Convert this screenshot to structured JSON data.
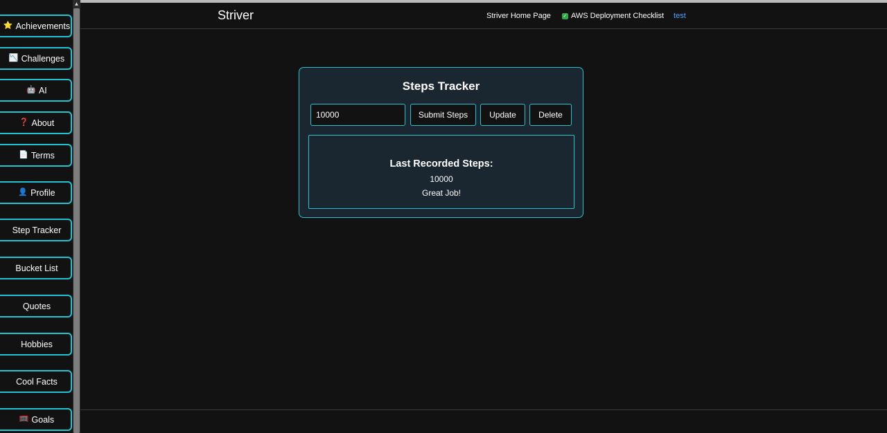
{
  "sidebar": {
    "items": [
      {
        "label": "Achievements",
        "icon": "⭐",
        "icon_name": "star-icon"
      },
      {
        "label": "Challenges",
        "icon": "📉",
        "icon_name": "chart-icon"
      },
      {
        "label": "AI",
        "icon": "🤖",
        "icon_name": "robot-icon"
      },
      {
        "label": "About",
        "icon": "❓",
        "icon_name": "question-icon"
      },
      {
        "label": "Terms",
        "icon": "📄",
        "icon_name": "document-icon"
      },
      {
        "label": "Profile",
        "icon": "👤",
        "icon_name": "user-icon"
      },
      {
        "label": "Step Tracker",
        "icon": "",
        "icon_name": ""
      },
      {
        "label": "Bucket List",
        "icon": "",
        "icon_name": ""
      },
      {
        "label": "Quotes",
        "icon": "",
        "icon_name": ""
      },
      {
        "label": "Hobbies",
        "icon": "",
        "icon_name": ""
      },
      {
        "label": "Cool Facts",
        "icon": "",
        "icon_name": ""
      },
      {
        "label": "Goals",
        "icon": "🥅",
        "icon_name": "goal-net-icon"
      }
    ]
  },
  "header": {
    "brand": "Striver",
    "nav": {
      "home": "Striver Home Page",
      "aws": "AWS Deployment Checklist",
      "test": "test"
    }
  },
  "tracker": {
    "title": "Steps Tracker",
    "input_value": "10000",
    "submit_label": "Submit Steps",
    "update_label": "Update",
    "delete_label": "Delete",
    "last_heading": "Last Recorded Steps:",
    "last_value": "10000",
    "message": "Great Job!"
  },
  "colors": {
    "accent": "#21c4d3",
    "background": "#121212",
    "card": "#1b2730",
    "link": "#4aa3ff",
    "check": "#2ea84a"
  }
}
